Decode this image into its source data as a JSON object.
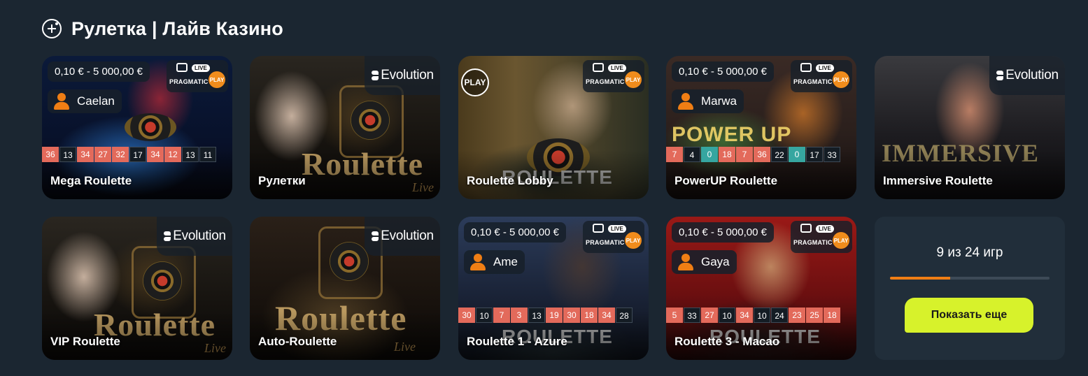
{
  "section": {
    "title": "Рулетка | Лайв Казино",
    "icon": "casino-plus-icon"
  },
  "providers": {
    "pragmatic": {
      "line1": "PRAGMATIC",
      "ball": "PLAY",
      "live": "LIVE"
    },
    "evolution": {
      "name": "Evolution"
    }
  },
  "decor": {
    "roulette_word": "Roulette",
    "live_word": "Live",
    "immersive_word": "IMMERSIVE",
    "powerup_word": "POWER UP",
    "lobby_word": "ROULETTE",
    "play_logo": "PLAY"
  },
  "colors": {
    "background": "#1b2631",
    "accent_button": "#d7f22b",
    "progress": "#f07e14",
    "red_number": "#e36a5b",
    "green_number": "#36a6a0",
    "black_number": "#141c24"
  },
  "games": [
    {
      "title": "Mega Roulette",
      "provider": "pragmatic",
      "bet_range": "0,10 € - 5 000,00 €",
      "dealer": "Caelan",
      "results": [
        {
          "n": "36",
          "c": "r"
        },
        {
          "n": "13",
          "c": "b"
        },
        {
          "n": "34",
          "c": "r"
        },
        {
          "n": "27",
          "c": "r"
        },
        {
          "n": "32",
          "c": "r"
        },
        {
          "n": "17",
          "c": "b"
        },
        {
          "n": "34",
          "c": "r"
        },
        {
          "n": "12",
          "c": "r"
        },
        {
          "n": "13",
          "c": "b"
        },
        {
          "n": "11",
          "c": "b"
        }
      ]
    },
    {
      "title": "Рулетки",
      "provider": "evolution"
    },
    {
      "title": "Roulette Lobby",
      "provider": "pragmatic"
    },
    {
      "title": "PowerUP Roulette",
      "provider": "pragmatic",
      "bet_range": "0,10 € - 5 000,00 €",
      "dealer": "Marwa",
      "results": [
        {
          "n": "7",
          "c": "r"
        },
        {
          "n": "4",
          "c": "b"
        },
        {
          "n": "0",
          "c": "g"
        },
        {
          "n": "18",
          "c": "r"
        },
        {
          "n": "7",
          "c": "r"
        },
        {
          "n": "36",
          "c": "r"
        },
        {
          "n": "22",
          "c": "b"
        },
        {
          "n": "0",
          "c": "g"
        },
        {
          "n": "17",
          "c": "b"
        },
        {
          "n": "33",
          "c": "b"
        }
      ]
    },
    {
      "title": "Immersive Roulette",
      "provider": "evolution"
    },
    {
      "title": "VIP Roulette",
      "provider": "evolution"
    },
    {
      "title": "Auto-Roulette",
      "provider": "evolution"
    },
    {
      "title": "Roulette 1 - Azure",
      "provider": "pragmatic",
      "bet_range": "0,10 € - 5 000,00 €",
      "dealer": "Ame",
      "results": [
        {
          "n": "30",
          "c": "r"
        },
        {
          "n": "10",
          "c": "b"
        },
        {
          "n": "7",
          "c": "r"
        },
        {
          "n": "3",
          "c": "r"
        },
        {
          "n": "13",
          "c": "b"
        },
        {
          "n": "19",
          "c": "r"
        },
        {
          "n": "30",
          "c": "r"
        },
        {
          "n": "18",
          "c": "r"
        },
        {
          "n": "34",
          "c": "r"
        },
        {
          "n": "28",
          "c": "b"
        }
      ]
    },
    {
      "title": "Roulette 3 - Macao",
      "provider": "pragmatic",
      "bet_range": "0,10 € - 5 000,00 €",
      "dealer": "Gaya",
      "results": [
        {
          "n": "5",
          "c": "r"
        },
        {
          "n": "33",
          "c": "b"
        },
        {
          "n": "27",
          "c": "r"
        },
        {
          "n": "10",
          "c": "b"
        },
        {
          "n": "34",
          "c": "r"
        },
        {
          "n": "10",
          "c": "b"
        },
        {
          "n": "24",
          "c": "b"
        },
        {
          "n": "23",
          "c": "r"
        },
        {
          "n": "25",
          "c": "r"
        },
        {
          "n": "18",
          "c": "r"
        }
      ]
    }
  ],
  "more": {
    "count_text": "9 из 24 игр",
    "progress_fraction": 0.375,
    "button_label": "Показать еще"
  }
}
